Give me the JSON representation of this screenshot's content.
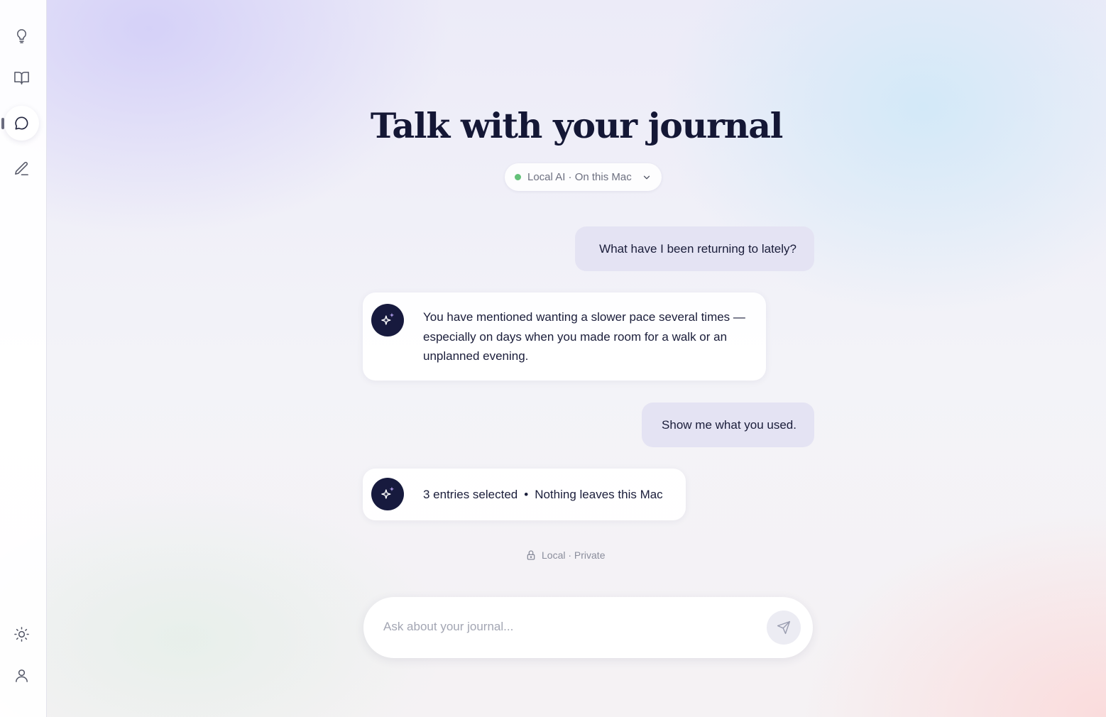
{
  "sidebar": {
    "items": [
      {
        "name": "insights",
        "icon": "lightbulb-icon"
      },
      {
        "name": "journal",
        "icon": "book-icon"
      },
      {
        "name": "chat",
        "icon": "chat-bubble-icon",
        "active": true
      },
      {
        "name": "write",
        "icon": "pencil-icon"
      }
    ],
    "bottom": [
      {
        "name": "theme",
        "icon": "sun-icon"
      },
      {
        "name": "profile",
        "icon": "user-icon"
      }
    ]
  },
  "main": {
    "title": "Talk with your journal",
    "model_selector": {
      "label": "Local AI · On this Mac",
      "status_color": "#64c179"
    },
    "messages": [
      {
        "role": "user",
        "text": "What have I been returning to lately?"
      },
      {
        "role": "assistant",
        "lines": [
          "You have mentioned wanting a slower pace several times —",
          "especially on days when you made room for a walk or an",
          "unplanned evening."
        ]
      },
      {
        "role": "user",
        "text": "Show me what you used."
      },
      {
        "role": "assistant",
        "part1": "3 entries selected",
        "separator": "•",
        "part2": "Nothing leaves this Mac"
      }
    ],
    "privacy_note": "Local · Private",
    "composer": {
      "placeholder": "Ask about your journal...",
      "value": ""
    }
  },
  "colors": {
    "accent": "#171a3e",
    "user_bubble": "#e3e2f2",
    "title": "#141735"
  }
}
